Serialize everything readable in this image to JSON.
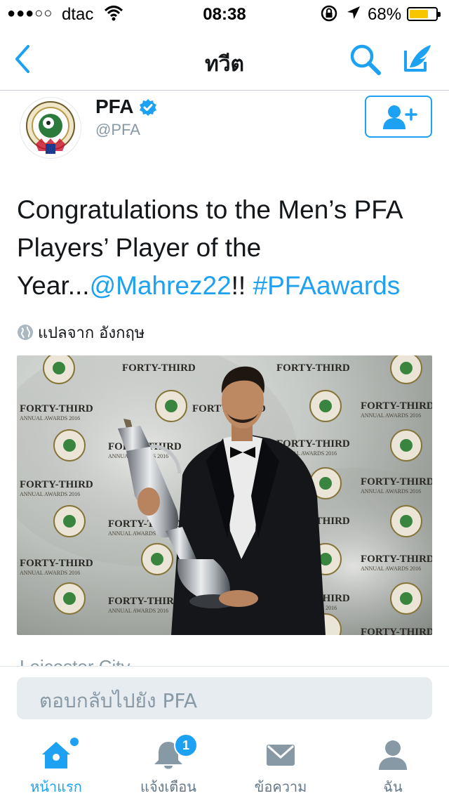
{
  "status_bar": {
    "signal": "●●●○○",
    "carrier": "dtac",
    "time": "08:38",
    "battery": "68%"
  },
  "nav": {
    "title": "ทวีต"
  },
  "tweet": {
    "name": "PFA",
    "handle": "@PFA",
    "text_part1": "Congratulations to the Men’s PFA Players’ Player of the Year...",
    "mention": "@Mahrez22",
    "text_part2": "!! ",
    "hashtag": "#PFAawards",
    "translate": "แปลจาก อังกฤษ",
    "location": "Leicester City"
  },
  "photo": {
    "backdrop_text": "FORTY-THIRD",
    "backdrop_sub": "ANNUAL AWARDS 2016"
  },
  "reply": {
    "placeholder": "ตอบกลับไปยัง PFA"
  },
  "tabs": [
    {
      "label": "หน้าแรก",
      "icon": "home-icon",
      "active": true
    },
    {
      "label": "แจ้งเตือน",
      "icon": "bell-icon",
      "badge": "1"
    },
    {
      "label": "ข้อความ",
      "icon": "envelope-icon"
    },
    {
      "label": "ฉัน",
      "icon": "person-icon"
    }
  ],
  "colors": {
    "accent": "#1da1f2",
    "text": "#14171a",
    "muted": "#8899a6"
  }
}
